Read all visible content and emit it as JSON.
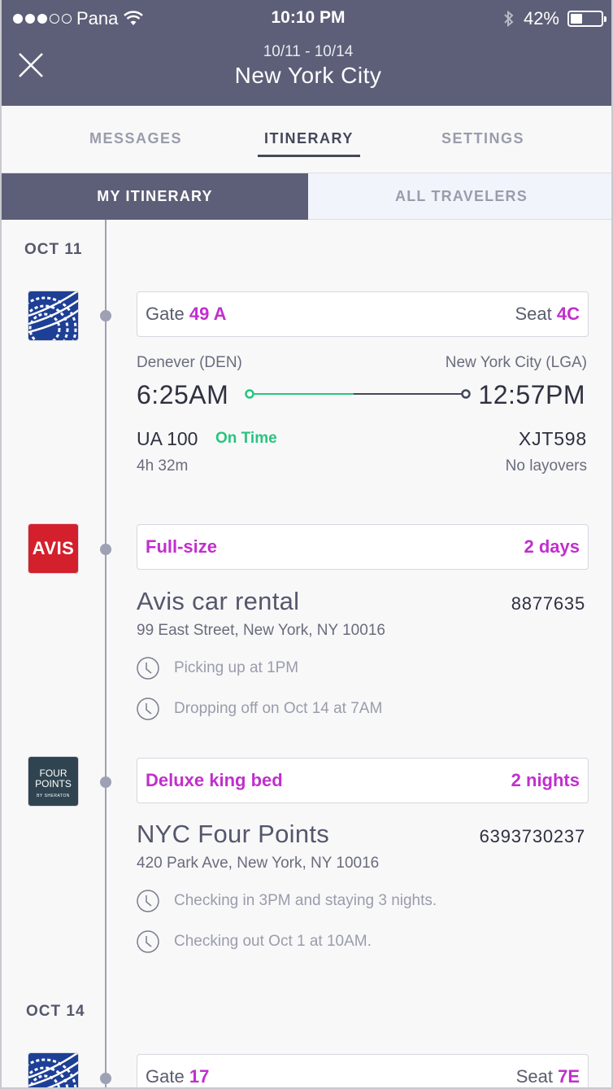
{
  "status_bar": {
    "carrier": "Pana",
    "time": "10:10 PM",
    "battery": "42%"
  },
  "header": {
    "dates": "10/11 - 10/14",
    "city": "New York City"
  },
  "tabs": [
    "MESSAGES",
    "ITINERARY",
    "SETTINGS"
  ],
  "active_tab": "ITINERARY",
  "segments": {
    "mine": "MY ITINERARY",
    "all": "ALL TRAVELERS"
  },
  "days": [
    "OCT 11",
    "OCT 14"
  ],
  "flight1": {
    "gate_label": "Gate",
    "gate": "49 A",
    "seat_label": "Seat",
    "seat": "4C",
    "from": "Denever (DEN)",
    "to": "New York City (LGA)",
    "depart": "6:25AM",
    "arrive": "12:57PM",
    "flight_no": "UA 100",
    "status": "On Time",
    "confirmation": "XJT598",
    "duration": "4h 32m",
    "layovers": "No layovers",
    "progress": 0.48
  },
  "car": {
    "logo": "AVIS",
    "type": "Full-size",
    "length": "2 days",
    "name": "Avis car rental",
    "confirmation": "8877635",
    "address": "99 East Street, New York, NY 10016",
    "pickup": "Picking up at 1PM",
    "dropoff": "Dropping off on Oct 14 at 7AM"
  },
  "hotel": {
    "logo_line1": "FOUR",
    "logo_line2": "POINTS",
    "logo_sub": "BY SHERATON",
    "room": "Deluxe king bed",
    "length": "2 nights",
    "name": "NYC Four Points",
    "confirmation": "6393730237",
    "address": "420 Park Ave, New York, NY 10016",
    "checkin": "Checking in 3PM and staying 3 nights.",
    "checkout": "Checking out Oct 1 at 10AM."
  },
  "flight2": {
    "gate_label": "Gate",
    "gate": "17",
    "seat_label": "Seat",
    "seat": "7E"
  },
  "colors": {
    "header": "#5d5f78",
    "accent": "#c12fcd",
    "on_time": "#27c57e"
  },
  "icons": [
    "close-icon",
    "wifi-icon",
    "bluetooth-icon",
    "clock-icon",
    "united-globe-icon"
  ]
}
